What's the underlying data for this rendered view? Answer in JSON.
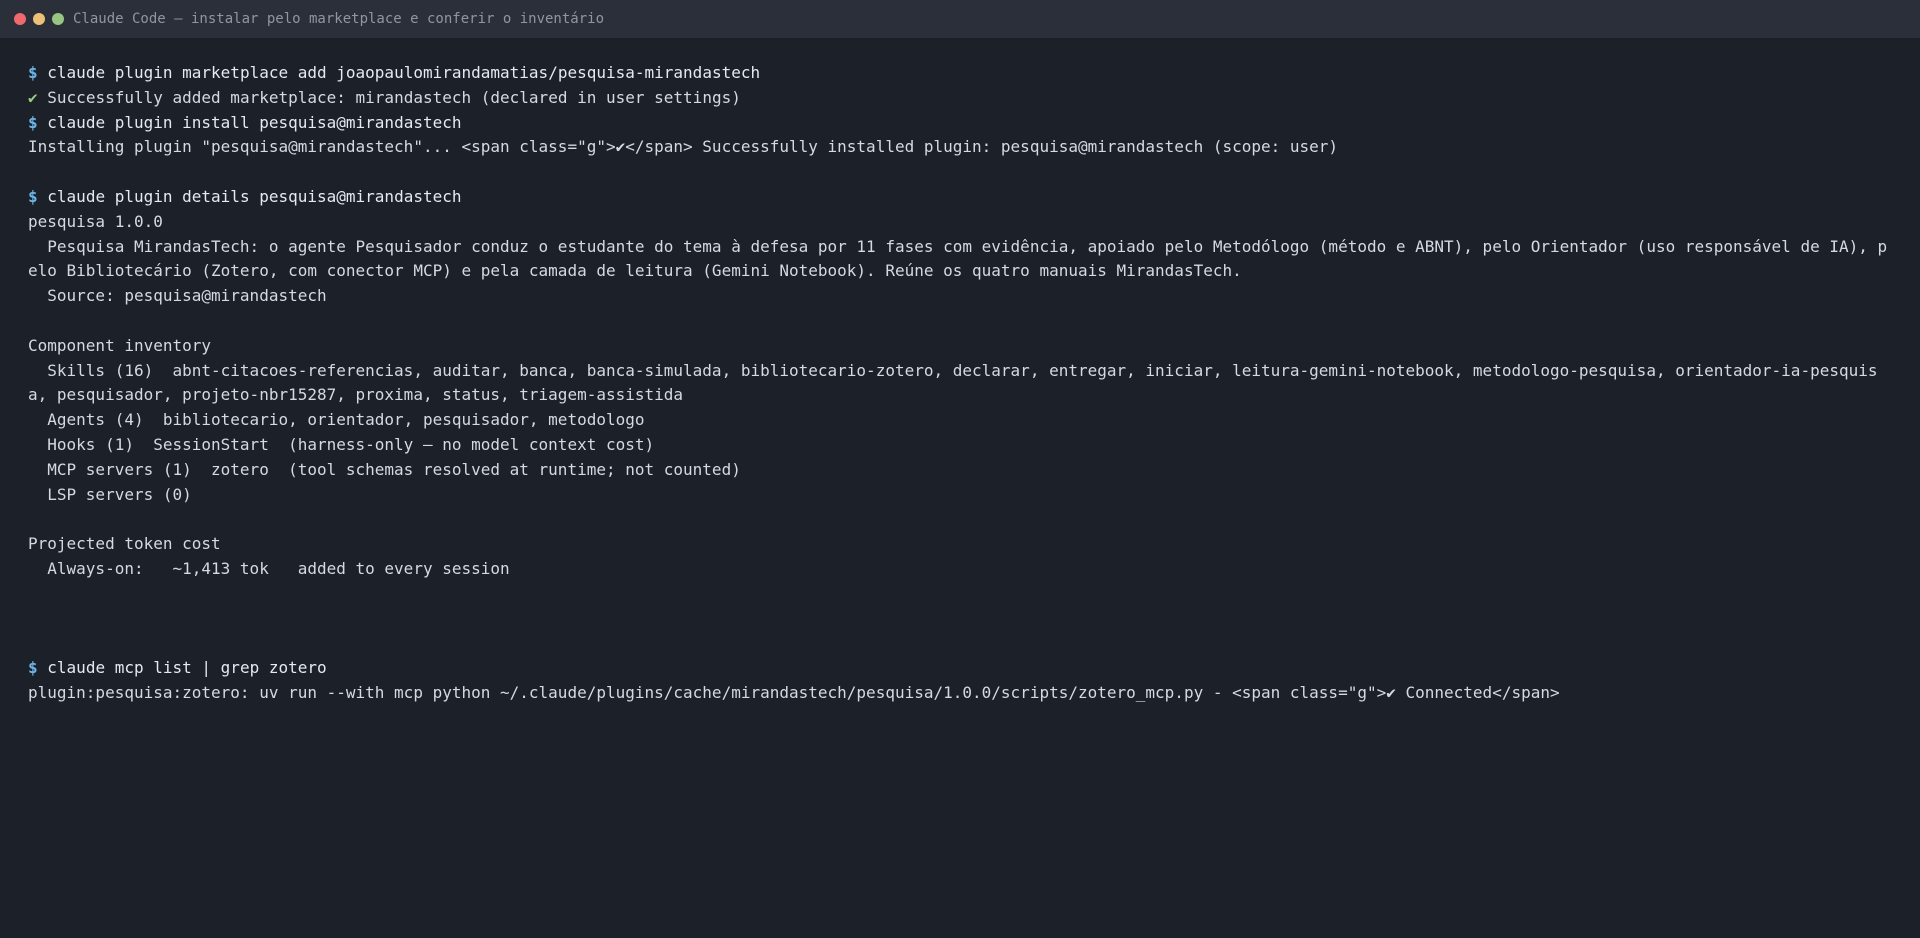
{
  "window": {
    "title": "Claude Code — instalar pelo marketplace e conferir o inventário",
    "controls": {
      "close_color": "#ee6a6f",
      "minimize_color": "#eec076",
      "maximize_color": "#99c582"
    }
  },
  "terminal": {
    "prompt_symbol": "$",
    "check_symbol": "✔",
    "lines": [
      {
        "kind": "cmd",
        "text": "claude plugin marketplace add joaopaulomirandamatias/pesquisa-mirandastech"
      },
      {
        "kind": "ok",
        "text": "Successfully added marketplace: mirandastech (declared in user settings)"
      },
      {
        "kind": "cmd",
        "text": "claude plugin install pesquisa@mirandastech"
      },
      {
        "kind": "out",
        "text": "Installing plugin \"pesquisa@mirandastech\"... <span class=\"g\">✔</span> Successfully installed plugin: pesquisa@mirandastech (scope: user)"
      },
      {
        "kind": "blank",
        "text": ""
      },
      {
        "kind": "cmd",
        "text": "claude plugin details pesquisa@mirandastech"
      },
      {
        "kind": "out",
        "text": "pesquisa 1.0.0"
      },
      {
        "kind": "out",
        "text": "  Pesquisa MirandasTech: o agente Pesquisador conduz o estudante do tema à defesa por 11 fases com evidência, apoiado pelo Metodólogo (método e ABNT), pelo Orientador (uso responsável de IA), pelo Bibliotecário (Zotero, com conector MCP) e pela camada de leitura (Gemini Notebook). Reúne os quatro manuais MirandasTech."
      },
      {
        "kind": "out",
        "text": "  Source: pesquisa@mirandastech"
      },
      {
        "kind": "blank",
        "text": ""
      },
      {
        "kind": "out",
        "text": "Component inventory"
      },
      {
        "kind": "out",
        "text": "  Skills (16)  abnt-citacoes-referencias, auditar, banca, banca-simulada, bibliotecario-zotero, declarar, entregar, iniciar, leitura-gemini-notebook, metodologo-pesquisa, orientador-ia-pesquisa, pesquisador, projeto-nbr15287, proxima, status, triagem-assistida"
      },
      {
        "kind": "out",
        "text": "  Agents (4)  bibliotecario, orientador, pesquisador, metodologo"
      },
      {
        "kind": "out",
        "text": "  Hooks (1)  SessionStart  (harness-only — no model context cost)"
      },
      {
        "kind": "out",
        "text": "  MCP servers (1)  zotero  (tool schemas resolved at runtime; not counted)"
      },
      {
        "kind": "out",
        "text": "  LSP servers (0)"
      },
      {
        "kind": "blank",
        "text": ""
      },
      {
        "kind": "out",
        "text": "Projected token cost"
      },
      {
        "kind": "out",
        "text": "  Always-on:   ~1,413 tok   added to every session"
      },
      {
        "kind": "blank",
        "text": ""
      },
      {
        "kind": "blank",
        "text": ""
      },
      {
        "kind": "blank",
        "text": ""
      },
      {
        "kind": "cmd",
        "text": "claude mcp list | grep zotero"
      },
      {
        "kind": "out",
        "text": "plugin:pesquisa:zotero: uv run --with mcp python ~/.claude/plugins/cache/mirandastech/pesquisa/1.0.0/scripts/zotero_mcp.py - <span class=\"g\">✔ Connected</span>"
      }
    ]
  }
}
